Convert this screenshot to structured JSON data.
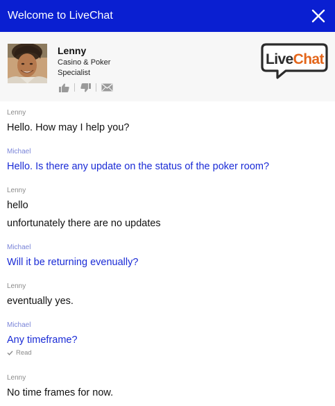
{
  "header": {
    "title": "Welcome to LiveChat",
    "close_icon": "close-icon",
    "background": "#0a1fd1"
  },
  "agent": {
    "name": "Lenny",
    "role": "Casino & Poker Specialist",
    "actions": [
      "thumbs-up-icon",
      "thumbs-down-icon",
      "envelope-icon"
    ]
  },
  "logo": {
    "part1": "Live",
    "part2": "Chat",
    "part1_color": "#2b2b2b",
    "part2_color": "#e3661b"
  },
  "messages": [
    {
      "author": "Lenny",
      "role": "agent",
      "lines": [
        "Hello. How may I help you?"
      ]
    },
    {
      "author": "Michael",
      "role": "visitor",
      "lines": [
        "Hello. Is there any update on the status of the poker room?"
      ]
    },
    {
      "author": "Lenny",
      "role": "agent",
      "lines": [
        "hello",
        "unfortunately there are no updates"
      ]
    },
    {
      "author": "Michael",
      "role": "visitor",
      "lines": [
        "Will it be returning evenually?"
      ]
    },
    {
      "author": "Lenny",
      "role": "agent",
      "lines": [
        "eventually yes."
      ]
    },
    {
      "author": "Michael",
      "role": "visitor",
      "lines": [
        "Any timeframe?"
      ],
      "status": "Read"
    },
    {
      "author": "Lenny",
      "role": "agent",
      "lines": [
        "No time frames for now."
      ]
    }
  ],
  "colors": {
    "visitor_text": "#1a2bd6",
    "agent_text": "#111111"
  }
}
